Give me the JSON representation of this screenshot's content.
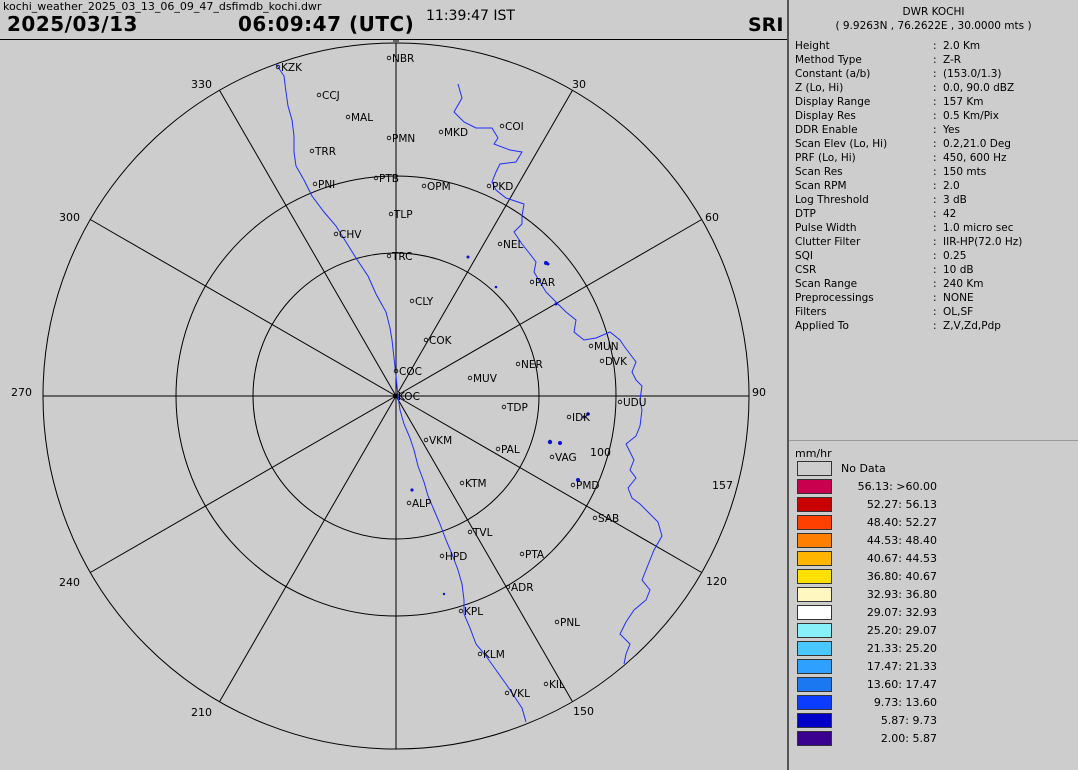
{
  "header": {
    "filename": "kochi_weather_2025_03_13_06_09_47_dsfimdb_kochi.dwr",
    "date": "2025/03/13",
    "utc_time": "06:09:47 (UTC)",
    "ist_time": "11:39:47 IST",
    "code": "SRI"
  },
  "station": {
    "name": "DWR KOCHI",
    "coords": "( 9.9263N , 76.2622E , 30.0000 mts )"
  },
  "params": [
    {
      "label": "Height",
      "value": "2.0 Km"
    },
    {
      "label": "Method Type",
      "value": "Z-R"
    },
    {
      "label": "Constant (a/b)",
      "value": "(153.0/1.3)"
    },
    {
      "label": "Z (Lo, Hi)",
      "value": "0.0, 90.0 dBZ"
    },
    {
      "label": "Display Range",
      "value": "157 Km"
    },
    {
      "label": "Display Res",
      "value": "0.5 Km/Pix"
    },
    {
      "label": "DDR Enable",
      "value": "Yes"
    },
    {
      "label": "Scan Elev (Lo, Hi)",
      "value": "0.2,21.0 Deg"
    },
    {
      "label": "PRF (Lo, Hi)",
      "value": "450, 600 Hz"
    },
    {
      "label": "Scan Res",
      "value": "150 mts"
    },
    {
      "label": "Scan RPM",
      "value": "2.0"
    },
    {
      "label": "Log Threshold",
      "value": "3 dB"
    },
    {
      "label": "DTP",
      "value": "42"
    },
    {
      "label": "Pulse Width",
      "value": "1.0 micro sec"
    },
    {
      "label": "Clutter Filter",
      "value": "IIR-HP(72.0 Hz)"
    },
    {
      "label": "SQI",
      "value": "0.25"
    },
    {
      "label": "CSR",
      "value": "10 dB"
    },
    {
      "label": "Scan Range",
      "value": "240 Km"
    },
    {
      "label": "Preprocessings",
      "value": "NONE"
    },
    {
      "label": "Filters",
      "value": "OL,SF"
    },
    {
      "label": "Applied To",
      "value": "Z,V,Zd,Pdp"
    }
  ],
  "legend": {
    "unit": "mm/hr",
    "no_data_label": "No Data",
    "no_data_color": "#cdcdcd",
    "items": [
      {
        "label": "56.13: >60.00",
        "color": "#c8004e"
      },
      {
        "label": "52.27: 56.13",
        "color": "#c80000"
      },
      {
        "label": "48.40: 52.27",
        "color": "#ff4000"
      },
      {
        "label": "44.53: 48.40",
        "color": "#ff8000"
      },
      {
        "label": "40.67: 44.53",
        "color": "#ffb400"
      },
      {
        "label": "36.80: 40.67",
        "color": "#ffe000"
      },
      {
        "label": "32.93: 36.80",
        "color": "#fff6c0"
      },
      {
        "label": "29.07: 32.93",
        "color": "#ffffff"
      },
      {
        "label": "25.20: 29.07",
        "color": "#88f0f8"
      },
      {
        "label": "21.33: 25.20",
        "color": "#48c8ff"
      },
      {
        "label": "17.47: 21.33",
        "color": "#2ea0ff"
      },
      {
        "label": "13.60: 17.47",
        "color": "#1c78f0"
      },
      {
        "label": "9.73: 13.60",
        "color": "#0c3cff"
      },
      {
        "label": "5.87: 9.73",
        "color": "#0000c8"
      },
      {
        "label": "2.00: 5.87",
        "color": "#3a0090"
      }
    ]
  },
  "radar": {
    "ring_color": "#000000",
    "coast_color": "#1e2dff",
    "echo_color": "#1010d0",
    "azimuth_labels": [
      "30",
      "60",
      "90",
      "120",
      "150",
      "210",
      "240",
      "270",
      "300",
      "330"
    ],
    "range_labels": [
      "100",
      "157"
    ],
    "cities": [
      "NBR",
      "KZK",
      "CCJ",
      "MAL",
      "PMN",
      "MKD",
      "COI",
      "TRR",
      "PNI",
      "PTB",
      "OPM",
      "PKD",
      "TLP",
      "CHV",
      "NEL",
      "TRC",
      "PAR",
      "CLY",
      "COK",
      "MUN",
      "DVK",
      "NER",
      "COC",
      "MUV",
      "KOC",
      "UDU",
      "TDP",
      "IDK",
      "VKM",
      "PAL",
      "VAG",
      "KTM",
      "PMD",
      "ALP",
      "SAB",
      "TVL",
      "HPD",
      "PTA",
      "ADR",
      "KPL",
      "PNL",
      "KLM",
      "KIL",
      "VKL"
    ]
  }
}
